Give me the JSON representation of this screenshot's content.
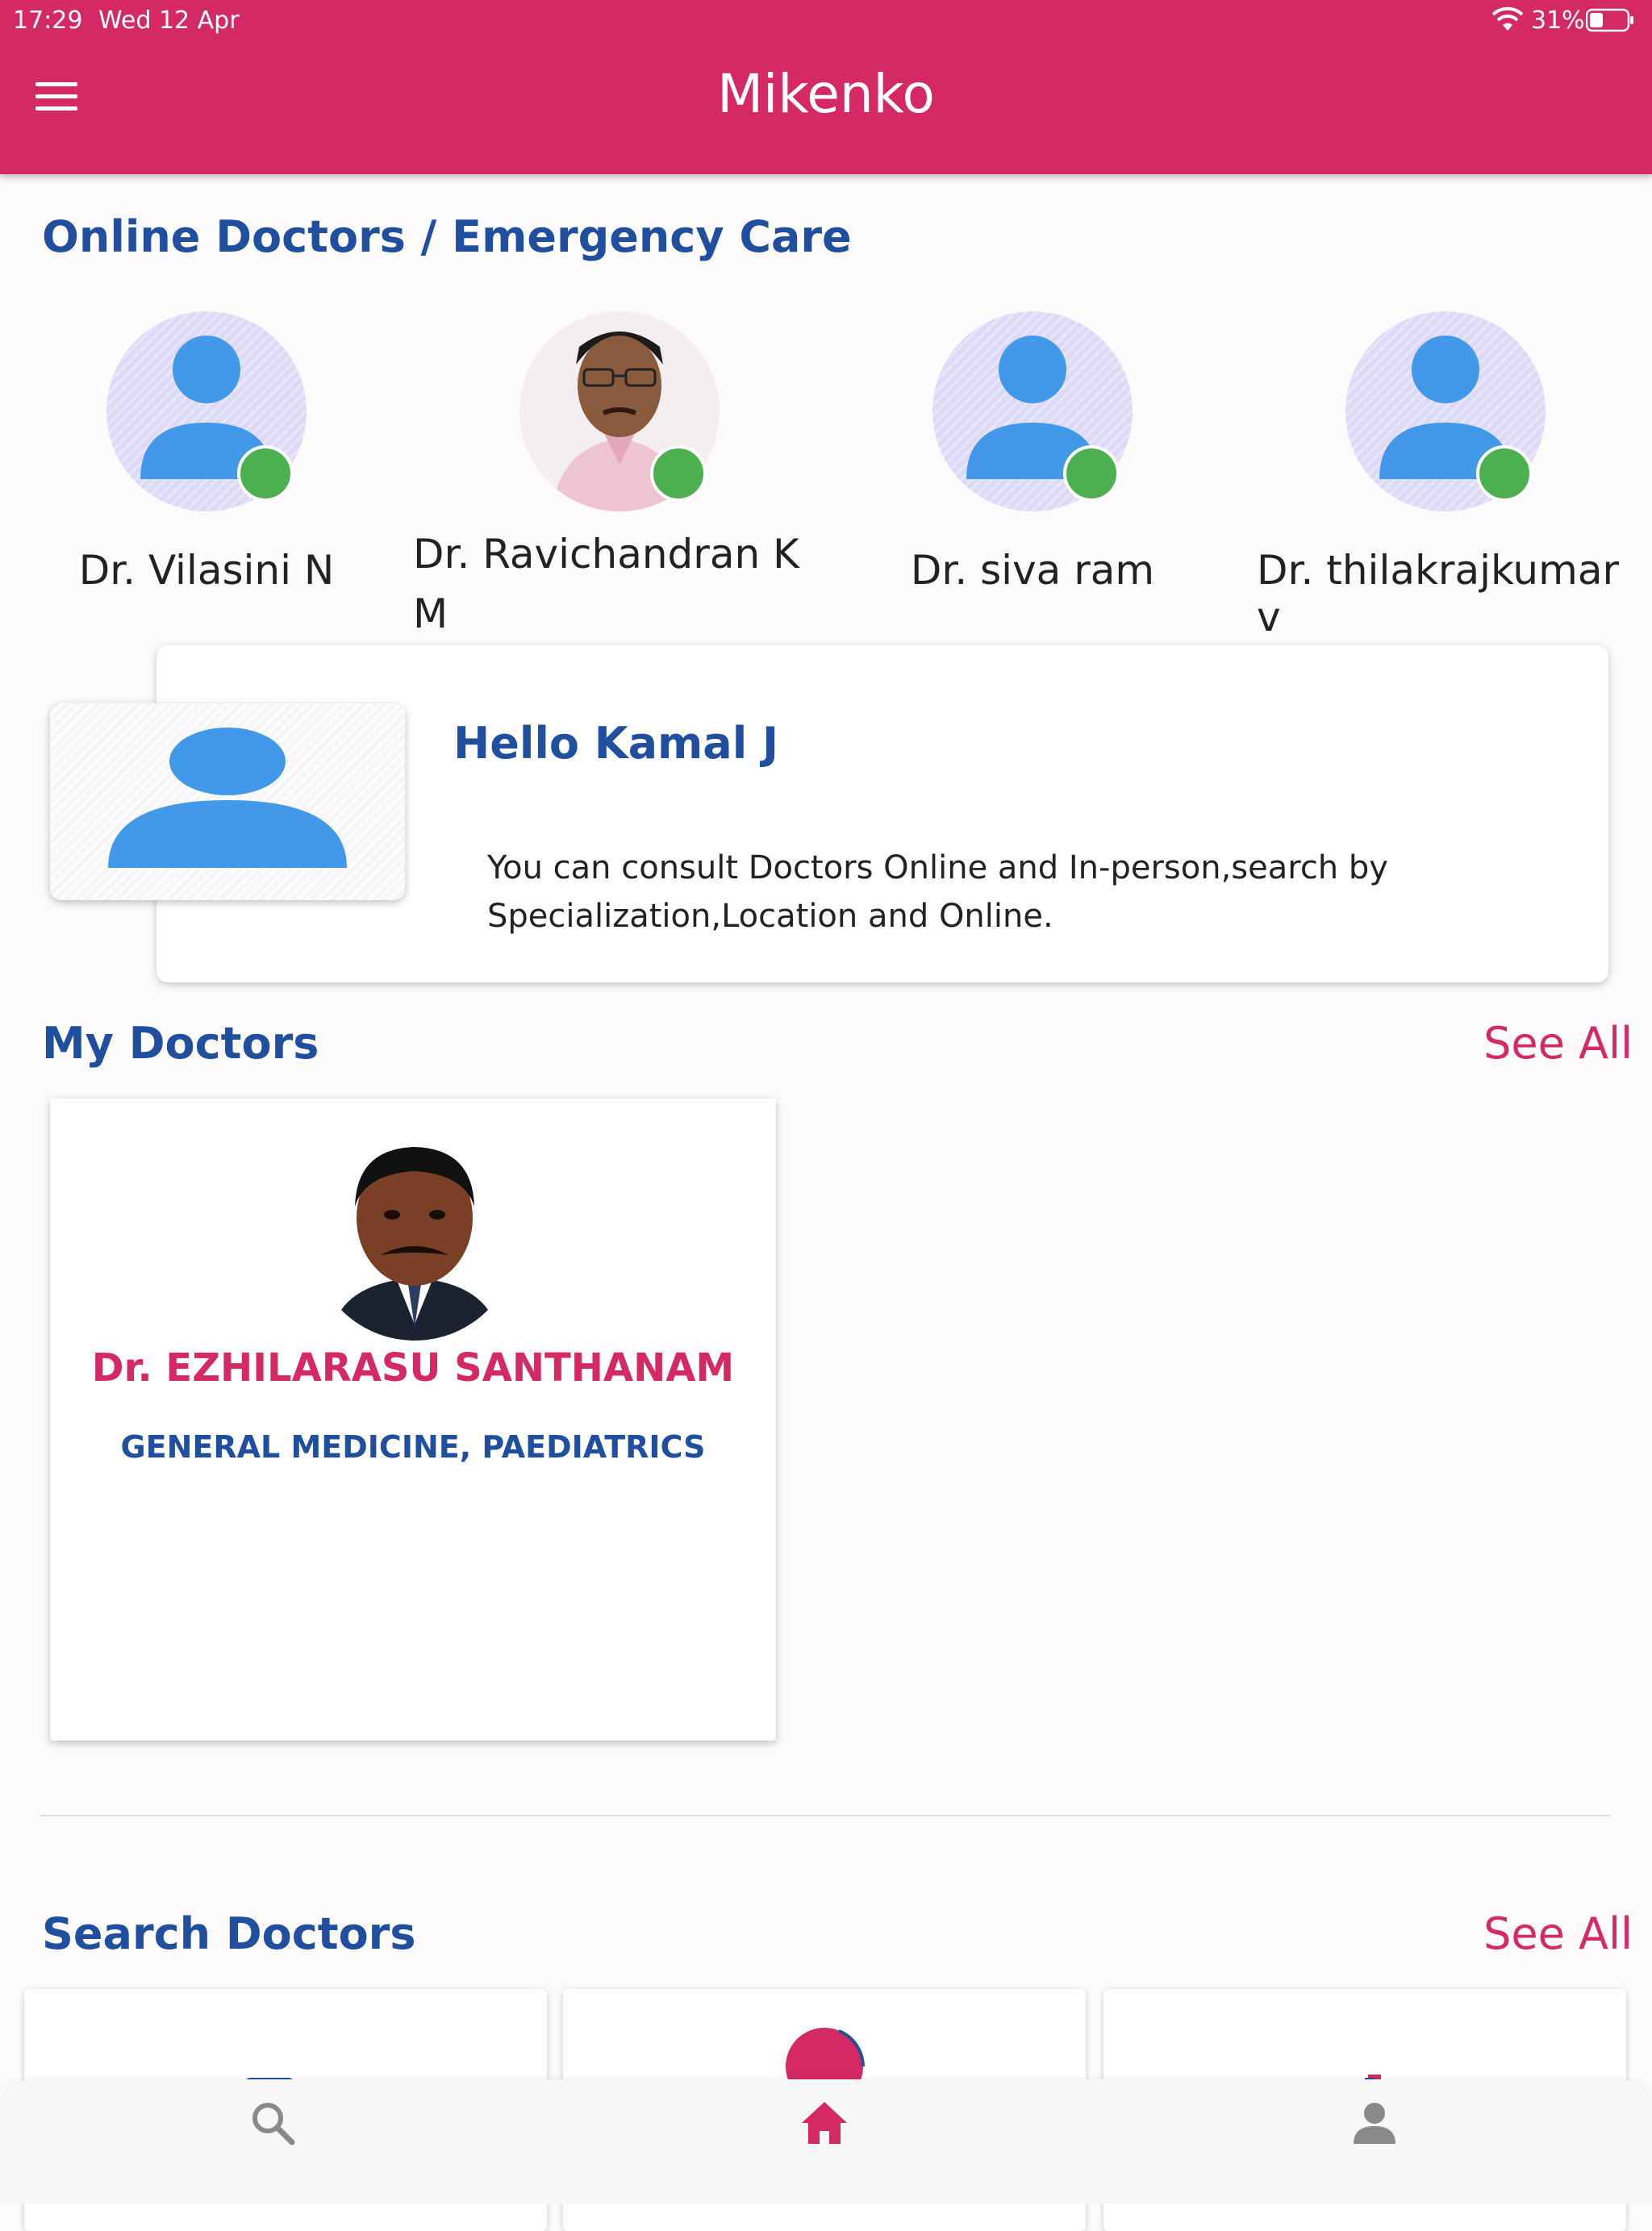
{
  "status_bar": {
    "time": "17:29",
    "date": "Wed 12 Apr",
    "battery": "31%"
  },
  "header": {
    "title": "Mikenko"
  },
  "online": {
    "title": "Online Doctors / Emergency Care",
    "doctors": [
      {
        "name": "Dr. Vilasini N"
      },
      {
        "name": "Dr. Ravichandran K M"
      },
      {
        "name": "Dr. siva ram"
      },
      {
        "name": "Dr. thilakrajkumar v"
      }
    ]
  },
  "hello": {
    "title": "Hello Kamal J",
    "message": "You can consult Doctors Online and In-person,search by Specialization,Location and Online."
  },
  "my_doctors": {
    "title": "My Doctors",
    "see_all": "See All",
    "doctor": {
      "name": "Dr. EZHILARASU SANTHANAM",
      "specialization": "GENERAL MEDICINE, PAEDIATRICS"
    }
  },
  "search_doctors": {
    "title": "Search Doctors",
    "see_all": "See All"
  },
  "bottom_nav": {
    "items": [
      "search-icon",
      "home-icon",
      "person-icon"
    ],
    "active": "home-icon"
  },
  "colors": {
    "primary": "#d52965",
    "title_blue": "#1f4f9e",
    "online": "#4caf50",
    "avatar_blue": "#4299e9"
  }
}
